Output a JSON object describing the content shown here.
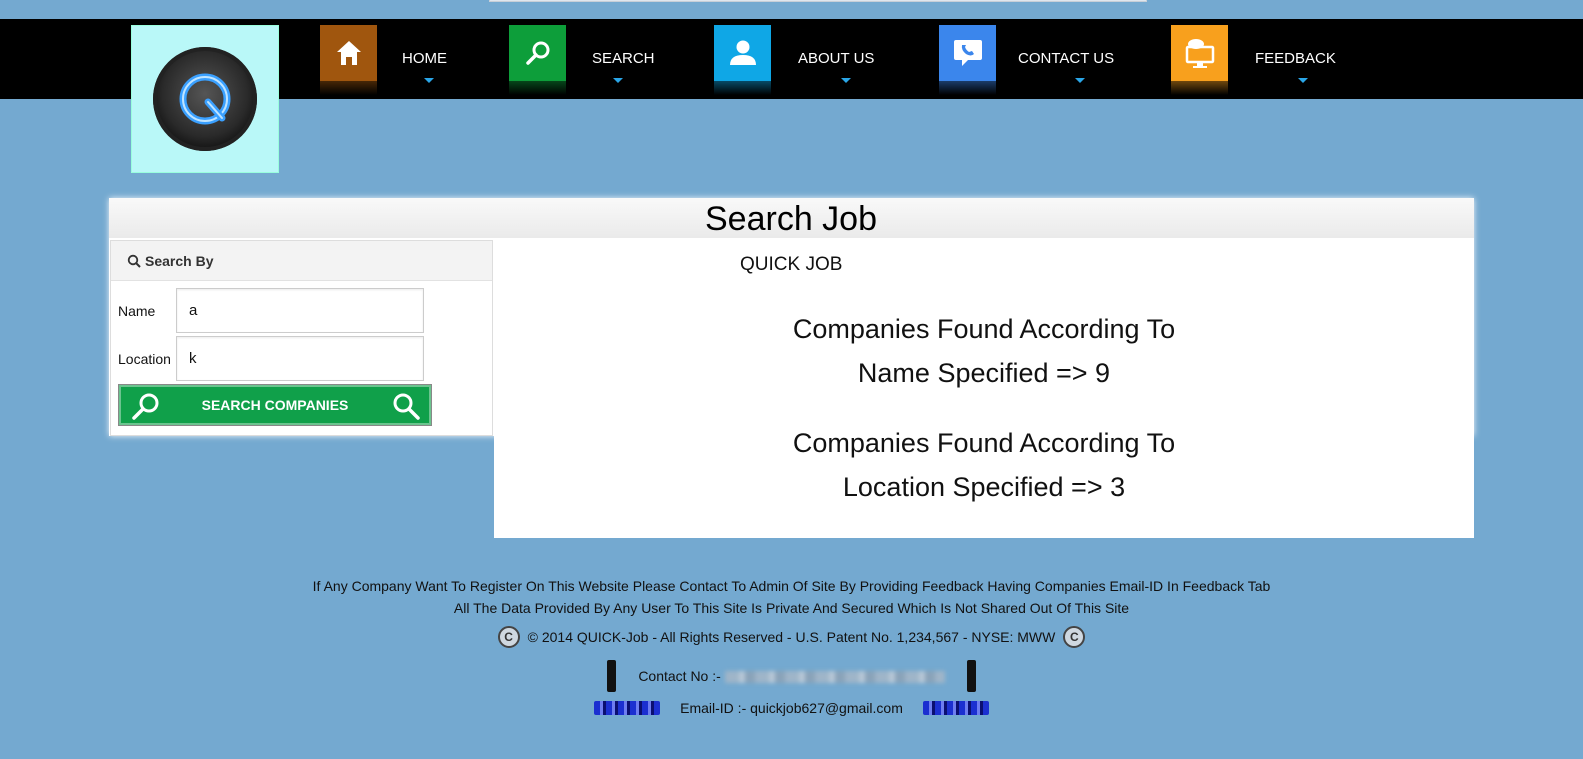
{
  "nav": {
    "items": [
      {
        "label": "HOME",
        "icon": "home-icon",
        "color": "#a0560e"
      },
      {
        "label": "SEARCH",
        "icon": "search-icon",
        "color": "#0d9e3a"
      },
      {
        "label": "ABOUT US",
        "icon": "user-icon",
        "color": "#0fa7e6"
      },
      {
        "label": "CONTACT US",
        "icon": "phone-icon",
        "color": "#3b86ec"
      },
      {
        "label": "FEEDBACK",
        "icon": "monitor-chat-icon",
        "color": "#f8a01d"
      }
    ]
  },
  "panel": {
    "title": "Search Job"
  },
  "sidebar": {
    "heading": "Search By",
    "name_label": "Name",
    "name_value": "a",
    "location_label": "Location",
    "location_value": "k",
    "button_label": "SEARCH COMPANIES"
  },
  "results": {
    "brand": "QUICK JOB",
    "name_line1": "Companies Found According To",
    "name_line2": "Name Specified => 9",
    "location_line1": "Companies Found According To",
    "location_line2": "Location Specified => 3"
  },
  "footer": {
    "line1": "If Any Company Want To Register On This Website Please Contact To Admin Of Site By Providing Feedback Having Companies Email-ID In Feedback Tab",
    "line2": "All The Data Provided By Any User To This Site Is Private And Secured Which Is Not Shared Out Of This Site",
    "copyright": "© 2014 QUICK-Job - All Rights Reserved - U.S. Patent No. 1,234,567 - NYSE: MWW",
    "contact_label": "Contact No :-",
    "email_label": "Email-ID :- quickjob627@gmail.com"
  },
  "colors": {
    "background": "#74a9d0",
    "navbar": "#000000",
    "logo_bg": "#b9f8f8",
    "button_green": "#10a04a",
    "caret_blue": "#2aa6e8"
  }
}
